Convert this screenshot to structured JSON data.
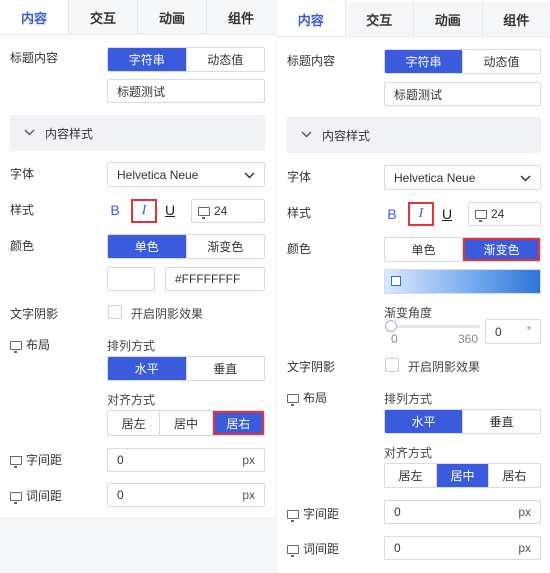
{
  "tabs": [
    "内容",
    "交互",
    "动画",
    "组件"
  ],
  "labels": {
    "title_content": "标题内容",
    "content_style": "内容样式",
    "font": "字体",
    "style": "样式",
    "color": "颜色",
    "text_shadow": "文字阴影",
    "layout": "布局",
    "arrangement": "排列方式",
    "alignment": "对齐方式",
    "letter_spacing": "字间距",
    "word_spacing": "词间距",
    "gradient_angle": "渐变角度"
  },
  "options": {
    "value_type": [
      "字符串",
      "动态值"
    ],
    "color_mode": [
      "单色",
      "渐变色"
    ],
    "direction": [
      "水平",
      "垂直"
    ],
    "align": [
      "居左",
      "居中",
      "居右"
    ]
  },
  "title_value": "标题测试",
  "font_value": "Helvetica Neue",
  "font_size": "24",
  "style_buttons": [
    "B",
    "I",
    "U"
  ],
  "shadow_checkbox_label": "开启阴影效果",
  "color_hex": "#FFFFFFFF",
  "px_unit": "px",
  "spacing_value": "0",
  "gradient": {
    "angle_min": "0",
    "angle_max": "360",
    "angle_value": "0",
    "degree_symbol": "°"
  },
  "left_state": {
    "color_mode": "单色",
    "align": "居右"
  },
  "right_state": {
    "color_mode": "渐变色",
    "align": "居中"
  },
  "colors": {
    "accent": "#3a5bdc",
    "highlight": "#e0333c"
  },
  "icons": [
    "chevron-down-icon",
    "monitor-icon",
    "dropdown-arrow-icon"
  ]
}
